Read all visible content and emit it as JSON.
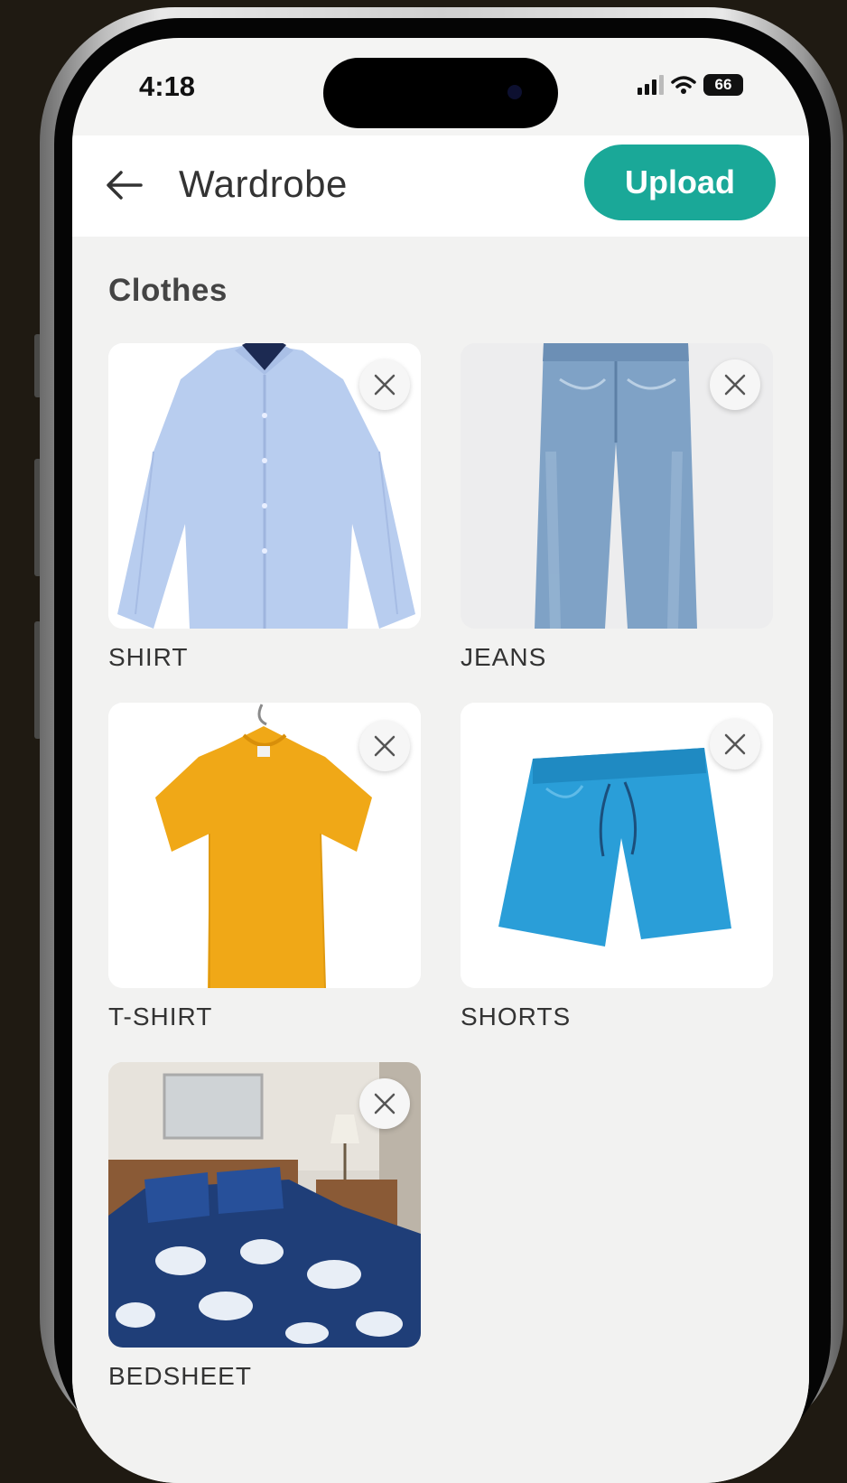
{
  "status_bar": {
    "time": "4:18",
    "battery": "66"
  },
  "header": {
    "title": "Wardrobe",
    "upload_label": "Upload"
  },
  "section": {
    "title": "Clothes"
  },
  "items": [
    {
      "label": "SHIRT"
    },
    {
      "label": "JEANS"
    },
    {
      "label": "T-SHIRT"
    },
    {
      "label": "SHORTS"
    },
    {
      "label": "BEDSHEET"
    }
  ],
  "colors": {
    "accent": "#1aa898",
    "shirt": "#b8cdef",
    "jeans": "#7fa2c6",
    "tshirt": "#f0a817",
    "shorts": "#2a9ed8",
    "bedsheet": "#1f3e78"
  },
  "icons": [
    "back-arrow-icon",
    "close-icon",
    "signal-icon",
    "wifi-icon",
    "battery-icon"
  ]
}
